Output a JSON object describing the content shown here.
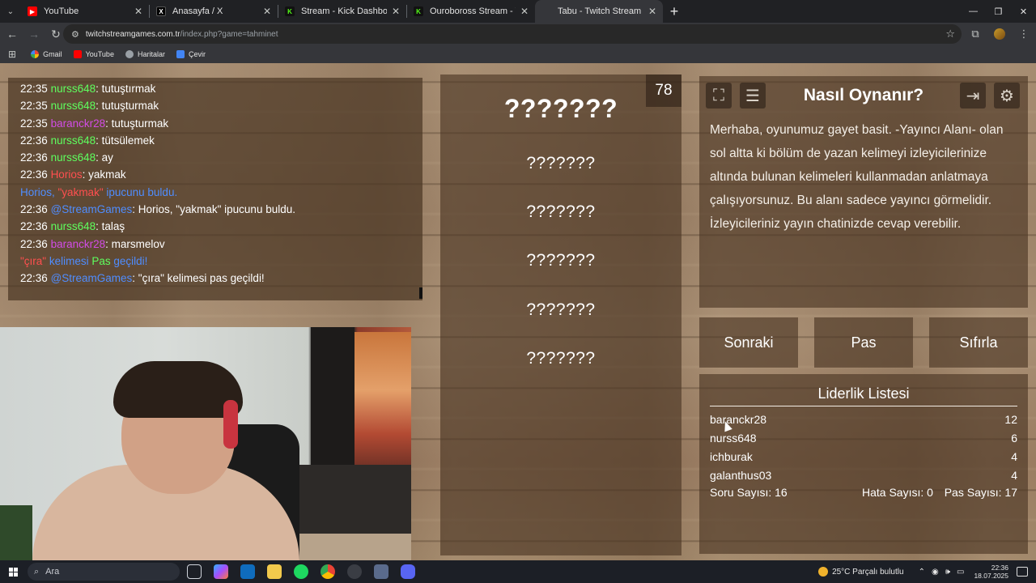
{
  "browser": {
    "tabs": [
      {
        "label": "YouTube",
        "icon": "youtube-icon",
        "active": false
      },
      {
        "label": "Anasayfa / X",
        "icon": "x-icon",
        "active": false
      },
      {
        "label": "Stream - Kick Dashboard",
        "icon": "kick-icon",
        "active": false
      },
      {
        "label": "Ouroboross Stream - Watch Live",
        "icon": "kick-icon",
        "active": false
      },
      {
        "label": "Tabu - Twitch Stream Games",
        "icon": "twitch-stream-games-icon",
        "active": true
      }
    ],
    "url_host": "twitchstreamgames.com.tr",
    "url_path": "/index.php?game=tahminet",
    "bookmarks": [
      {
        "label": "Gmail",
        "icon": "gmail-icon"
      },
      {
        "label": "YouTube",
        "icon": "youtube-icon"
      },
      {
        "label": "Haritalar",
        "icon": "maps-icon"
      },
      {
        "label": "Çevir",
        "icon": "translate-icon"
      }
    ]
  },
  "chat": {
    "lines": [
      {
        "time": "22:35",
        "user": "nurss648",
        "color": "green",
        "text": ": tutuştırmak"
      },
      {
        "time": "22:35",
        "user": "nurss648",
        "color": "green",
        "text": ": tutuşturmak"
      },
      {
        "time": "22:35",
        "user": "baranckr28",
        "color": "purple",
        "text": ": tutuşturmak"
      },
      {
        "time": "22:36",
        "user": "nurss648",
        "color": "green",
        "text": ": tütsülemek"
      },
      {
        "time": "22:36",
        "user": "nurss648",
        "color": "green",
        "text": ": ay"
      },
      {
        "time": "22:36",
        "user": "Horios",
        "color": "red",
        "text": ": yakmak"
      },
      {
        "system": true,
        "parts": [
          "Horios, ",
          "\"yakmak\"",
          " ipucunu buldu."
        ]
      },
      {
        "time": "22:36",
        "user": "@StreamGames",
        "color": "blue",
        "text": ": Horios, \"yakmak\" ipucunu buldu."
      },
      {
        "time": "22:36",
        "user": "nurss648",
        "color": "green",
        "text": ": talaş"
      },
      {
        "time": "22:36",
        "user": "baranckr28",
        "color": "purple",
        "text": ": marsmelov"
      },
      {
        "system2": true,
        "parts": [
          "\"çıra\"",
          " kelimesi ",
          "Pas",
          " geçildi!"
        ]
      },
      {
        "time": "22:36",
        "user": "@StreamGames",
        "color": "blue",
        "text": ": \"çıra\" kelimesi pas geçildi!"
      }
    ]
  },
  "game": {
    "counter": "78",
    "main_word": "???????",
    "forbidden": [
      "???????",
      "???????",
      "???????",
      "???????",
      "???????"
    ]
  },
  "info": {
    "title": "Nasıl Oynanır?",
    "text": "Merhaba, oyunumuz gayet basit. -Yayıncı Alanı- olan sol altta ki bölüm de yazan kelimeyi izleyicilerinize altında bulunan kelimeleri kullanmadan anlatmaya çalışıyorsunuz. Bu alanı sadece yayıncı görmelidir. İzleyicileriniz yayın chatinizde cevap verebilir."
  },
  "buttons": {
    "next": "Sonraki",
    "pass": "Pas",
    "reset": "Sıfırla"
  },
  "leaderboard": {
    "title": "Liderlik Listesi",
    "rows": [
      {
        "name": "baranckr28",
        "score": "12"
      },
      {
        "name": "nurss648",
        "score": "6"
      },
      {
        "name": "ichburak",
        "score": "4"
      },
      {
        "name": "galanthus03",
        "score": "4"
      }
    ],
    "stats": {
      "questions": "Soru Sayısı: 16",
      "errors": "Hata Sayısı: 0",
      "passes": "Pas Sayısı: 17"
    }
  },
  "taskbar": {
    "search_placeholder": "Ara",
    "weather": "25°C  Parçalı bulutlu",
    "time": "22:36",
    "date": "18.07.2025"
  },
  "colors": {
    "green": "#5eff5e",
    "purple": "#d24ce6",
    "red": "#ff4f4f",
    "blue": "#4f8dff"
  }
}
